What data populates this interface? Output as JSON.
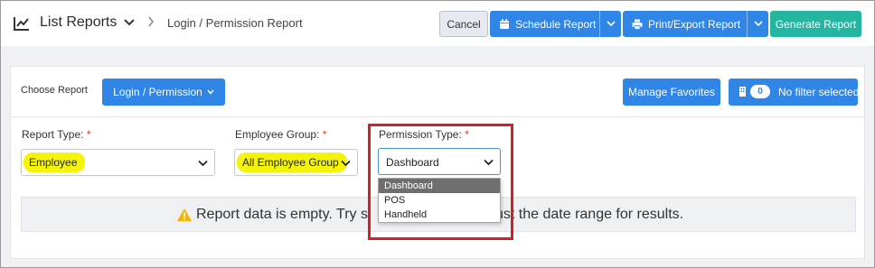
{
  "header": {
    "title": "List Reports",
    "breadcrumb": "Login / Permission Report"
  },
  "toolbar": {
    "cancel_label": "Cancel",
    "schedule_label": "Schedule Report",
    "print_label": "Print/Export Report",
    "generate_label": "Generate Report"
  },
  "chooser": {
    "label": "Choose Report",
    "selected_report": "Login / Permission",
    "manage_favorites_label": "Manage Favorites",
    "filter_count": "0",
    "filter_label": "No filter selected"
  },
  "fields": {
    "report_type": {
      "label": "Report Type:",
      "required_mark": "*",
      "value": "Employee"
    },
    "employee_group": {
      "label": "Employee Group:",
      "required_mark": "*",
      "value": "All Employee Group"
    },
    "permission_type": {
      "label": "Permission Type:",
      "required_mark": "*",
      "value": "Dashboard",
      "options": [
        "Dashboard",
        "POS",
        "Handheld"
      ]
    }
  },
  "empty_state": {
    "message_start": "Report data is empty. Try s",
    "message_end": "ust the date range for results."
  },
  "colors": {
    "primary": "#2f86e6",
    "generate": "#24b5a0",
    "highlight": "#f4f40a",
    "annotation": "#d42020",
    "warning": "#f5b400"
  },
  "icons": [
    "chart-line-icon",
    "chevron-down-icon",
    "chevron-right-icon",
    "calendar-icon",
    "printer-icon",
    "filter-icon",
    "warning-icon"
  ]
}
